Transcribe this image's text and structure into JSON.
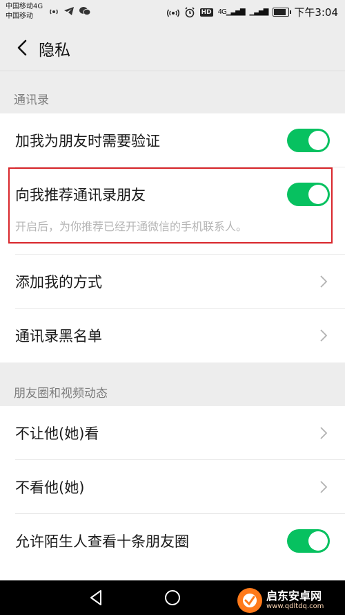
{
  "status_bar": {
    "carrier_line1": "中国移动4G",
    "carrier_line2": "中国移动",
    "hd_badge": "HD",
    "signal_label": "4G",
    "time": "下午3:04",
    "icons": [
      "hotspot-icon",
      "telegram-icon",
      "wechat-icon",
      "nfc-icon",
      "alarm-icon",
      "battery-icon"
    ]
  },
  "header": {
    "title": "隐私",
    "back_icon": "chevron-left-icon"
  },
  "sections": {
    "contacts": {
      "label": "通讯录",
      "items": [
        {
          "label": "加我为朋友时需要验证",
          "toggle": true
        },
        {
          "label": "向我推荐通讯录朋友",
          "desc": "开启后，为你推荐已经开通微信的手机联系人。",
          "toggle": true
        },
        {
          "label": "添加我的方式"
        },
        {
          "label": "通讯录黑名单"
        }
      ]
    },
    "moments": {
      "label": "朋友圈和视频动态",
      "items": [
        {
          "label": "不让他(她)看"
        },
        {
          "label": "不看他(她)"
        },
        {
          "label": "允许陌生人查看十条朋友圈",
          "toggle": true
        }
      ]
    }
  },
  "colors": {
    "toggle_on": "#07c160",
    "highlight_border": "#d9262b",
    "background": "#ededed"
  },
  "watermark": {
    "title": "启东安卓网",
    "url": "www.qdltdq.com"
  }
}
